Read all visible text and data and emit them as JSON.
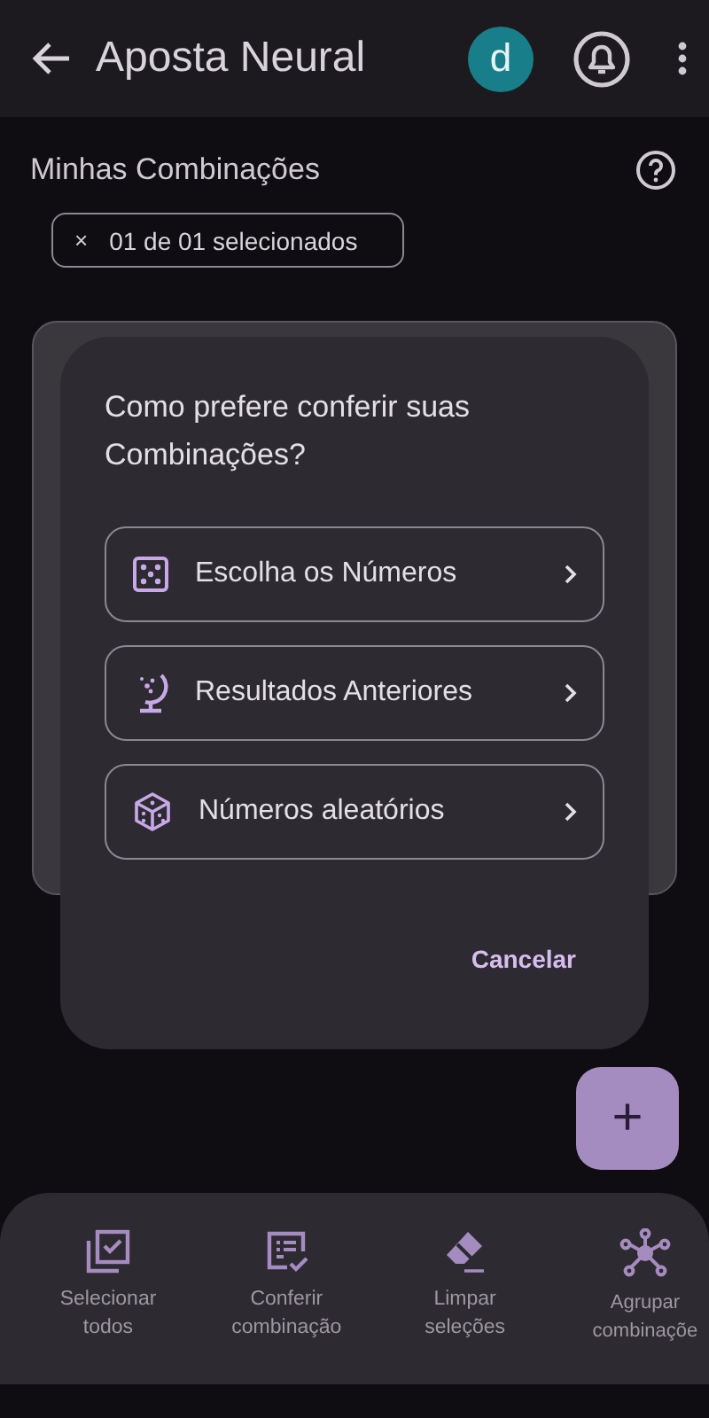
{
  "app_bar": {
    "title": "Aposta Neural",
    "avatar": "d"
  },
  "section": {
    "title": "Minhas Combinações"
  },
  "chip": {
    "close": "×",
    "label": "01 de 01 selecionados"
  },
  "dialog": {
    "title": "Como prefere conferir suas Combinações?",
    "options": [
      {
        "kind": "dice-one",
        "label": "Escolha os Números"
      },
      {
        "kind": "globe",
        "label": "Resultados Anteriores"
      },
      {
        "kind": "dice",
        "label": "Números aleatórios"
      }
    ],
    "cancel": "Cancelar"
  },
  "fab": {
    "label": "+"
  },
  "bottom_actions": [
    {
      "kind": "select-all",
      "label": "Selecionar todos"
    },
    {
      "kind": "checklist",
      "label": "Conferir combinação"
    },
    {
      "kind": "eraser",
      "label": "Limpar seleções"
    },
    {
      "kind": "network",
      "label": "Agrupar combinaçõe"
    }
  ]
}
